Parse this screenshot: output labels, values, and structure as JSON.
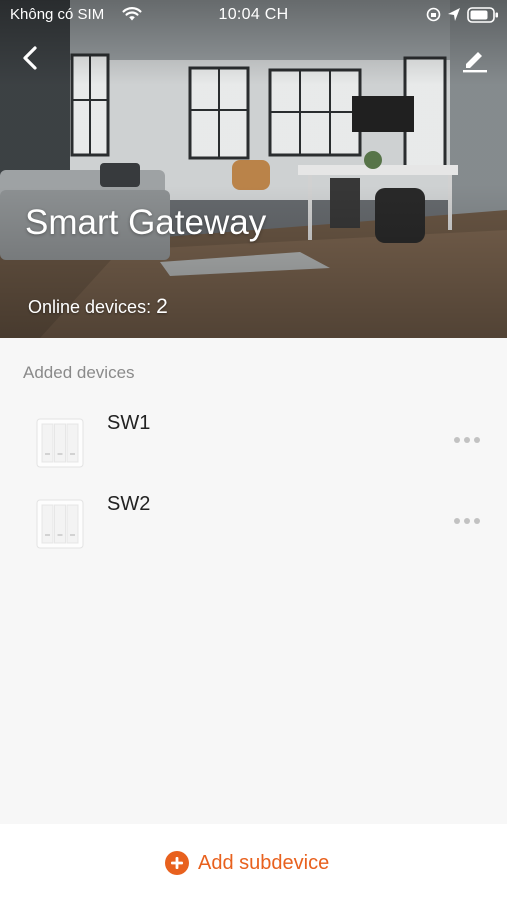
{
  "status_bar": {
    "carrier": "Không có SIM",
    "time": "10:04 CH",
    "icons": [
      "wifi-icon",
      "orientation-lock-icon",
      "location-icon",
      "battery-icon"
    ]
  },
  "header": {
    "back_icon": "chevron-left-icon",
    "edit_icon": "pencil-icon",
    "title": "Smart Gateway",
    "online_label": "Online devices:",
    "online_count": "2"
  },
  "devices": {
    "section_label": "Added devices",
    "items": [
      {
        "name": "SW1",
        "icon": "wall-switch-icon",
        "menu_icon": "more-dots-icon"
      },
      {
        "name": "SW2",
        "icon": "wall-switch-icon",
        "menu_icon": "more-dots-icon"
      }
    ]
  },
  "footer": {
    "add_label": "Add subdevice",
    "add_icon": "plus-circle-icon"
  },
  "colors": {
    "accent": "#e8611e",
    "background": "#f7f7f7",
    "label_gray": "#8a8a8a",
    "text_dark": "#222222"
  }
}
